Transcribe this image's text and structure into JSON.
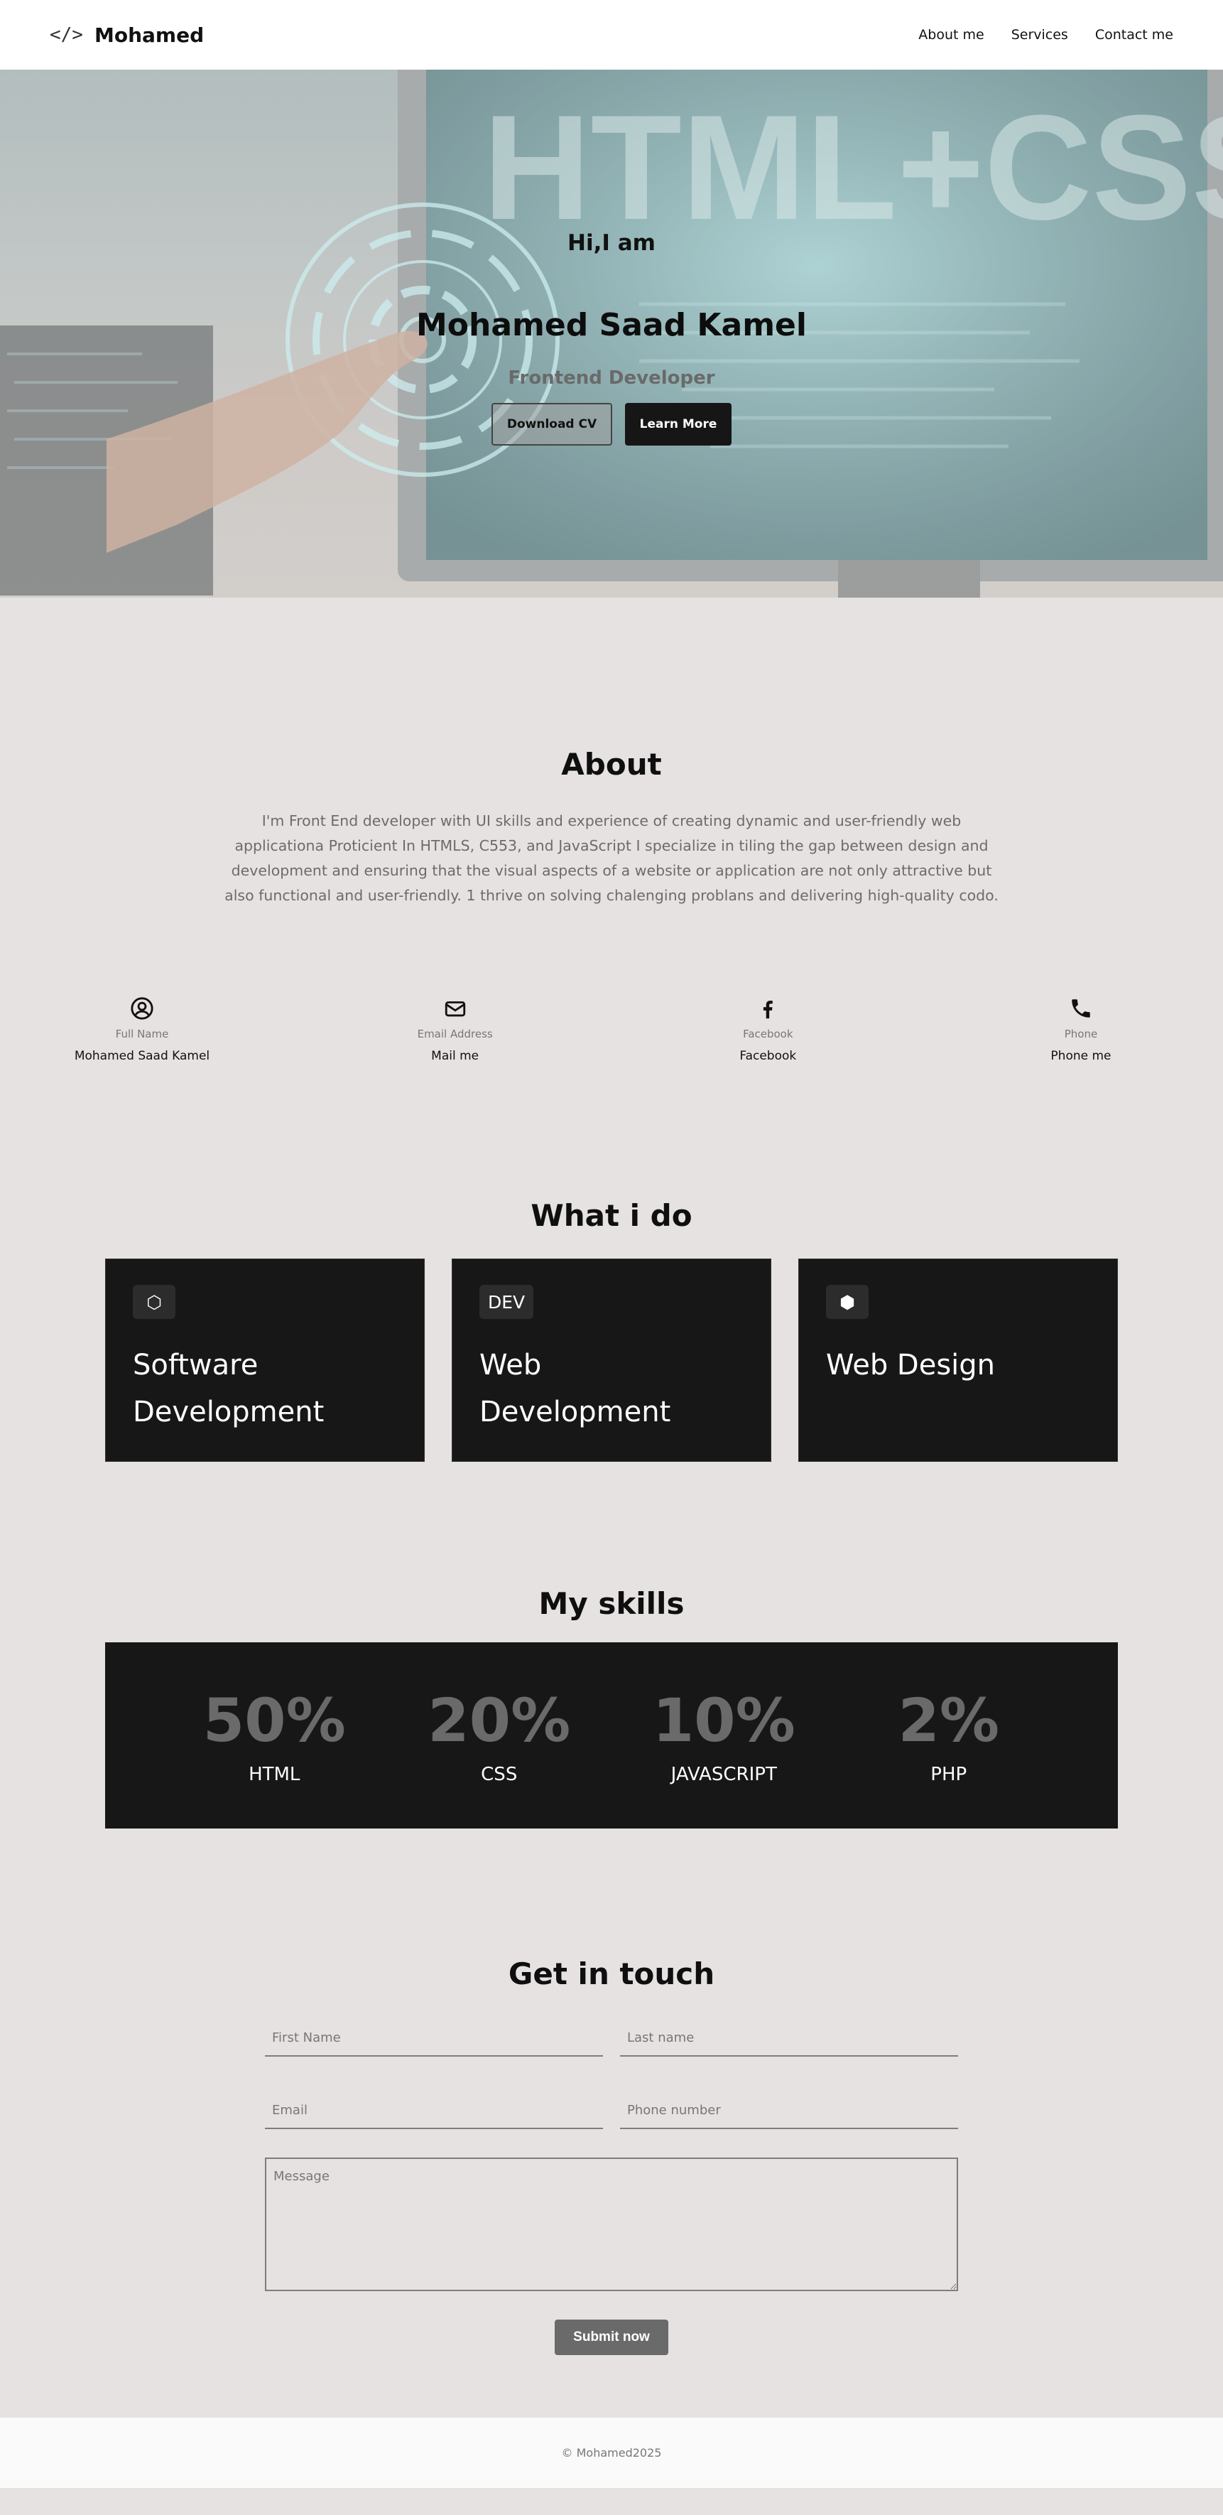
{
  "nav": {
    "brand_icon": "</>",
    "brand_name": "Mohamed",
    "links": [
      "About me",
      "Services",
      "Contact me"
    ]
  },
  "hero": {
    "greeting": "Hi,I am",
    "name": "Mohamed Saad Kamel",
    "role": "Frontend Developer",
    "download_button": "Download CV",
    "learn_button": "Learn More",
    "background_text": "HTML+CSS"
  },
  "about": {
    "title": "About",
    "text": "I'm Front End developer with UI skills and experience of creating dynamic and user-friendly web applicationa Proticient In HTMLS, C553, and JavaScript I specialize in tiling the gap between design and development and ensuring that the visual aspects of a website or application are not only attractive but also functional and user-friendly. 1 thrive on solving chalenging problans and delivering high-quality codo.",
    "contacts": [
      {
        "icon": "user-circle-icon",
        "label": "Full Name",
        "value": "Mohamed Saad Kamel"
      },
      {
        "icon": "mail-icon",
        "label": "Email Address",
        "value": "Mail me"
      },
      {
        "icon": "facebook-icon",
        "label": "Facebook",
        "value": "Facebook"
      },
      {
        "icon": "phone-icon",
        "label": "Phone",
        "value": "Phone me"
      }
    ]
  },
  "services": {
    "title": "What i do",
    "cards": [
      {
        "badge": "⬡",
        "title": "Software Development"
      },
      {
        "badge": "DEV",
        "title": "Web Development"
      },
      {
        "badge": "⬢",
        "title": "Web Design"
      }
    ]
  },
  "skills": {
    "title": "My skills",
    "items": [
      {
        "percent": "50%",
        "name": "HTML"
      },
      {
        "percent": "20%",
        "name": "CSS"
      },
      {
        "percent": "10%",
        "name": "JAVASCRIPT"
      },
      {
        "percent": "2%",
        "name": "PHP"
      }
    ]
  },
  "contact": {
    "title": "Get in touch",
    "first_name_placeholder": "First Name",
    "last_name_placeholder": "Last name",
    "email_placeholder": "Email",
    "phone_placeholder": "Phone number",
    "message_placeholder": "Message",
    "submit_label": "Submit now"
  },
  "footer": {
    "text": "© Mohamed2025"
  },
  "colors": {
    "page_bg": "#e6e2e1",
    "card_bg": "#181717",
    "accent_gray": "#6a6a6a"
  }
}
